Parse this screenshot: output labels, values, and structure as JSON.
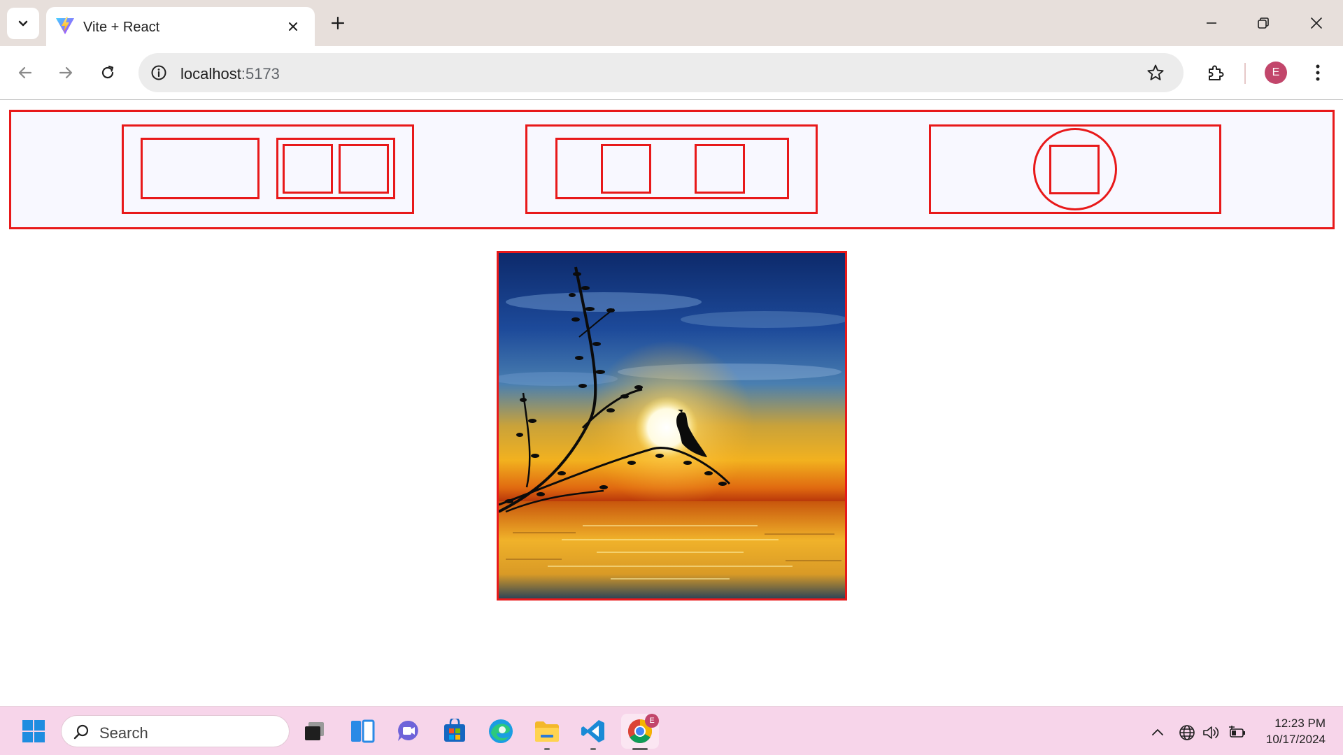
{
  "browser": {
    "tab_title": "Vite + React",
    "url_host": "localhost",
    "url_port": ":5173",
    "profile_initial": "E"
  },
  "page": {
    "border_color": "#e8191a",
    "navbar_bg": "#f8f8ff",
    "hero_image": "sunset-bird-silhouette"
  },
  "taskbar": {
    "search_placeholder": "Search",
    "time": "12:23 PM",
    "date": "10/17/2024",
    "chrome_badge": "E"
  }
}
